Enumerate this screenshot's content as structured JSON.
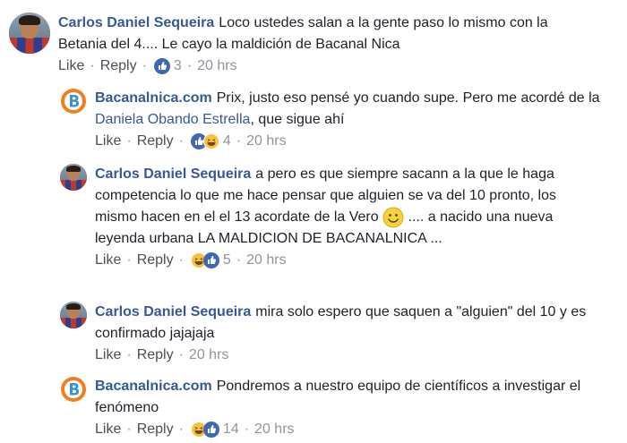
{
  "comments": [
    {
      "author": "Carlos Daniel Sequeira",
      "text": "Loco ustedes salan a la gente paso lo mismo con la Betania del 4.... Le cayo la maldición de Bacanal Nica",
      "like": "Like",
      "reply": "Reply",
      "reaction_count": "3",
      "time": "20 hrs"
    },
    {
      "author": "Bacanalnica.com",
      "text_before": "Prix, justo eso pensé yo cuando supe. Pero me acordé de la ",
      "mention": "Daniela Obando Estrella",
      "text_after": ", que sigue ahí",
      "like": "Like",
      "reply": "Reply",
      "reaction_count": "4",
      "time": "20 hrs"
    },
    {
      "author": "Carlos Daniel Sequeira",
      "text_before": "a pero es que siempre sacann a la que le haga competencia lo que me hace pensar que alguien se va del 10 pronto, los mismo hacen en el el 13 acordate de la Vero",
      "text_after": ".... a nacido una nueva leyenda urbana LA MALDICION DE BACANALNICA ...",
      "like": "Like",
      "reply": "Reply",
      "reaction_count": "5",
      "time": "20 hrs"
    },
    {
      "author": "Carlos Daniel Sequeira",
      "text": "mira solo espero que saquen a \"alguien\" del 10 y es confirmado jajajaja",
      "like": "Like",
      "reply": "Reply",
      "time": "20 hrs"
    },
    {
      "author": "Bacanalnica.com",
      "text": "Pondremos a nuestro equipo de científicos a investigar el fenómeno",
      "like": "Like",
      "reply": "Reply",
      "reaction_count": "14",
      "time": "20 hrs"
    }
  ],
  "icons": {
    "like_reaction": "thumbs-up-icon",
    "haha_reaction": "haha-emoji-icon",
    "smile_emoji": "smile-emoji-icon",
    "brand_logo": "bacanalnica-logo"
  },
  "colors": {
    "author": "#365899",
    "meta": "#90949c",
    "like_blue": "#4267b2",
    "haha_yellow": "#f7c33d",
    "brand_orange": "#f0801e"
  }
}
